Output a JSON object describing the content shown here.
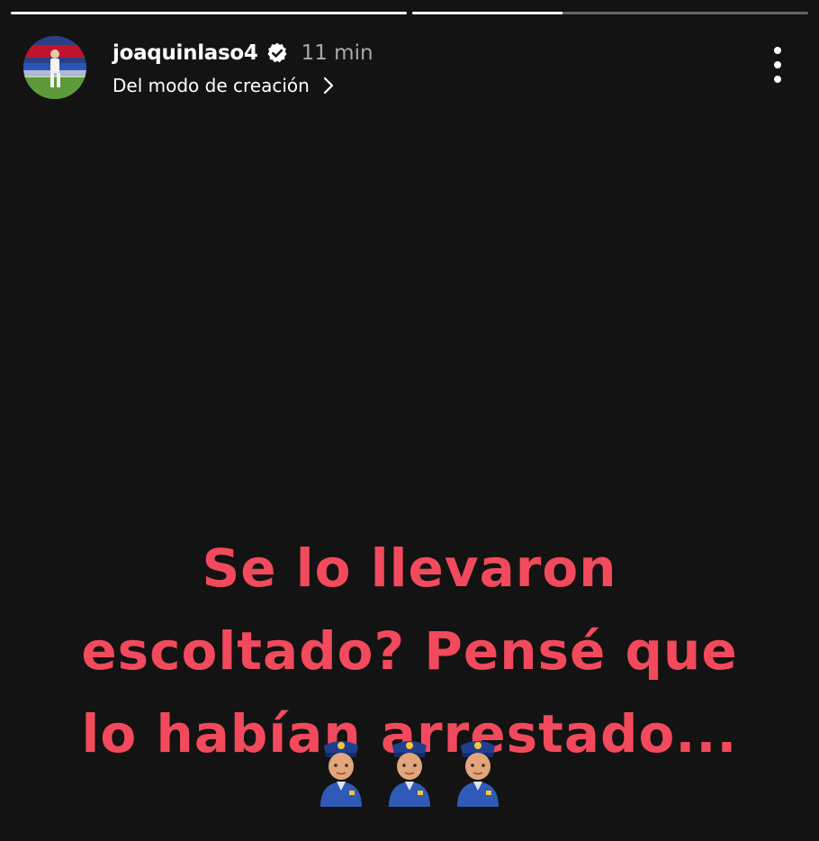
{
  "story": {
    "progress": [
      1.0,
      0.38
    ],
    "user": {
      "username": "joaquinlaso4",
      "verified": true,
      "time_ago": "11 min",
      "subtitle": "Del modo de creación"
    },
    "caption": {
      "lines": [
        "Se lo llevaron",
        "escoltado? Pensé que",
        "lo habían arrestado..."
      ],
      "emoji": [
        "police-officer-emoji",
        "police-officer-emoji",
        "police-officer-emoji"
      ],
      "color": "#f24a5c"
    },
    "background_color": "#131313"
  },
  "icons": {
    "verified": "verified-badge-icon",
    "chevron": "chevron-right-icon",
    "more": "more-vertical-icon"
  }
}
